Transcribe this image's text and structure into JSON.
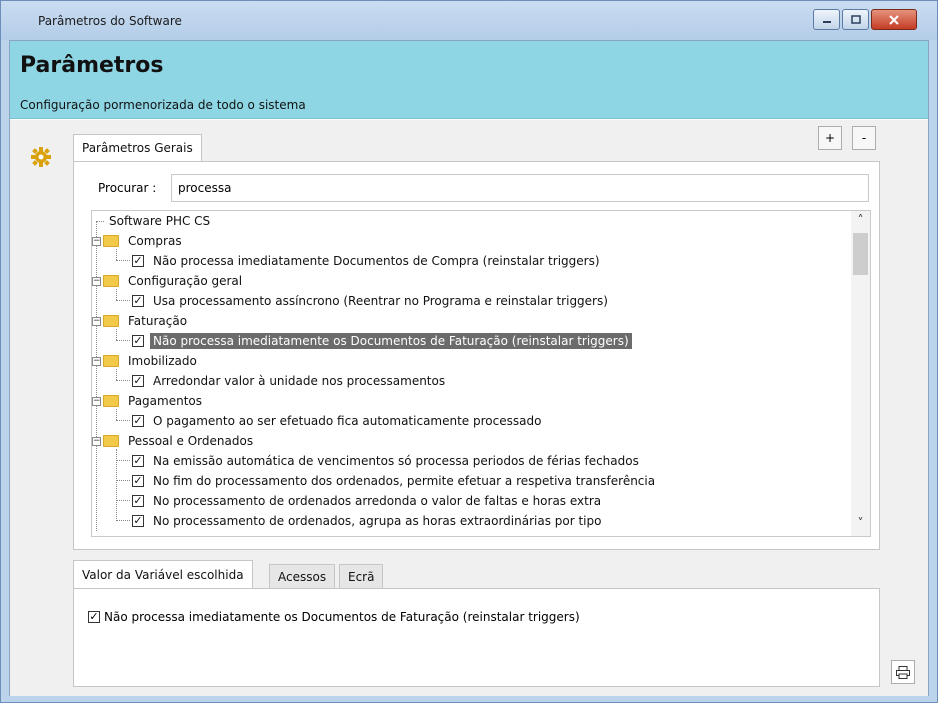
{
  "window": {
    "title": "Parâmetros do Software",
    "min_icon": "minimize-icon",
    "max_icon": "maximize-icon",
    "close_icon": "close-icon"
  },
  "header": {
    "title": "Parâmetros",
    "subtitle": "Configuração pormenorizada de todo o sistema",
    "background": "#8fd6e5"
  },
  "toolbar": {
    "plus_label": "+",
    "minus_label": "-"
  },
  "top_tabs": [
    {
      "label": "Parâmetros Gerais",
      "active": true
    }
  ],
  "search": {
    "label": "Procurar :",
    "value": "processa",
    "placeholder": ""
  },
  "tree": {
    "root": "Software PHC CS",
    "groups": [
      {
        "label": "Compras",
        "items": [
          "Não processa imediatamente Documentos de Compra (reinstalar triggers)"
        ]
      },
      {
        "label": "Configuração geral",
        "items": [
          "Usa processamento assíncrono (Reentrar no Programa e reinstalar triggers)"
        ]
      },
      {
        "label": "Faturação",
        "items": [
          "Não processa imediatamente os Documentos de Faturação (reinstalar triggers)"
        ]
      },
      {
        "label": "Imobilizado",
        "items": [
          "Arredondar valor à unidade nos processamentos"
        ]
      },
      {
        "label": "Pagamentos",
        "items": [
          "O pagamento ao ser efetuado fica automaticamente processado"
        ]
      },
      {
        "label": "Pessoal e Ordenados",
        "items": [
          "Na emissão automática de vencimentos só processa periodos de férias fechados",
          "No fim do processamento dos ordenados, permite efetuar a respetiva transferência",
          "No processamento de ordenados arredonda o valor de faltas e horas extra",
          "No processamento de ordenados, agrupa as horas extraordinárias por tipo"
        ]
      }
    ],
    "selected": "Não processa imediatamente os Documentos de Faturação (reinstalar triggers)"
  },
  "bottom_tabs": [
    {
      "label": "Valor da Variável escolhida",
      "active": true
    },
    {
      "label": "Acessos",
      "active": false
    },
    {
      "label": "Ecrã",
      "active": false
    }
  ],
  "value_panel": {
    "checkbox_label": "Não processa imediatamente os Documentos de Faturação (reinstalar triggers)",
    "checked": true
  },
  "icons": {
    "settings": "gear-icon",
    "print": "printer-icon",
    "folder": "folder-icon"
  },
  "colors": {
    "selection": "#6b6b6b",
    "folder": "#f3c94a",
    "gear": "#d9a20c"
  }
}
